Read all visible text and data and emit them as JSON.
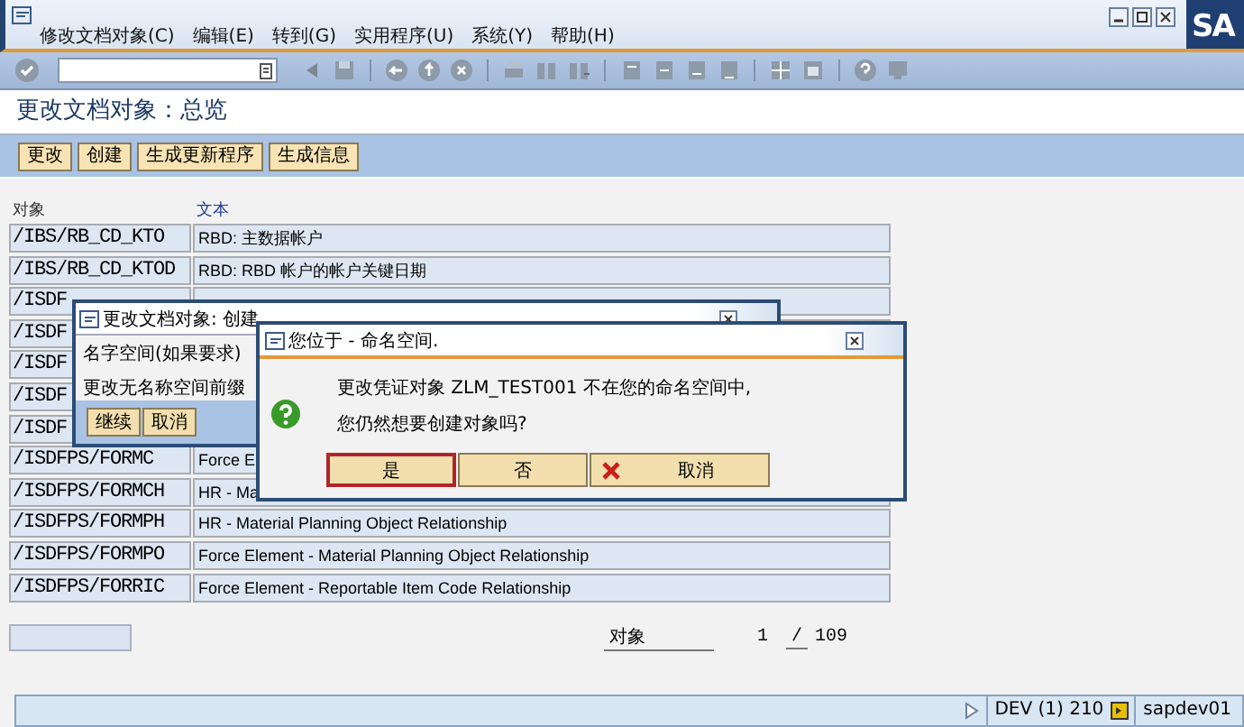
{
  "window": {
    "menu": [
      "修改文档对象(C)",
      "编辑(E)",
      "转到(G)",
      "实用程序(U)",
      "系统(Y)",
      "帮助(H)"
    ],
    "logo": "SA"
  },
  "title": "更改文档对象：总览",
  "app_toolbar": [
    "更改",
    "创建",
    "生成更新程序",
    "生成信息"
  ],
  "table": {
    "columns": [
      "对象",
      "文本"
    ],
    "rows": [
      {
        "object": "/IBS/RB_CD_KTO",
        "text": "RBD: 主数据帐户"
      },
      {
        "object": "/IBS/RB_CD_KTOD",
        "text": "RBD: RBD 帐户的帐户关键日期"
      },
      {
        "object": "/ISDF",
        "text": ""
      },
      {
        "object": "/ISDF",
        "text": ""
      },
      {
        "object": "/ISDF",
        "text": ""
      },
      {
        "object": "/ISDF",
        "text": ""
      },
      {
        "object": "/ISDF",
        "text": ""
      },
      {
        "object": "/ISDFPS/FORMC",
        "text": "Force E"
      },
      {
        "object": "/ISDFPS/FORMCH",
        "text": "HR - Ma"
      },
      {
        "object": "/ISDFPS/FORMPH",
        "text": "HR - Material Planning Object Relationship"
      },
      {
        "object": "/ISDFPS/FORMPO",
        "text": "Force Element - Material Planning Object Relationship"
      },
      {
        "object": "/ISDFPS/FORRIC",
        "text": "Force Element - Reportable Item Code Relationship"
      }
    ]
  },
  "pager": {
    "label": "对象",
    "current": "1",
    "separator": "/",
    "total": "109"
  },
  "status_bar": {
    "system": "DEV (1) 210",
    "server": "sapdev01"
  },
  "dialogs": [
    {
      "title": "更改文档对象: 创建",
      "lines": [
        "名字空间(如果要求)",
        "更改无名称空间前缀"
      ],
      "buttons": [
        {
          "label": "继续",
          "kind": "plain",
          "selected": false
        },
        {
          "label": "取消",
          "kind": "plain",
          "selected": false
        }
      ]
    },
    {
      "title": "您位于 - 命名空间.",
      "lines": [
        "更改凭证对象 ZLM_TEST001 不在您的命名空间中,",
        "您仍然想要创建对象吗?"
      ],
      "buttons": [
        {
          "label": "是",
          "kind": "plain",
          "selected": true
        },
        {
          "label": "否",
          "kind": "plain",
          "selected": false
        },
        {
          "label": "取消",
          "kind": "cancel",
          "selected": false
        }
      ]
    }
  ]
}
